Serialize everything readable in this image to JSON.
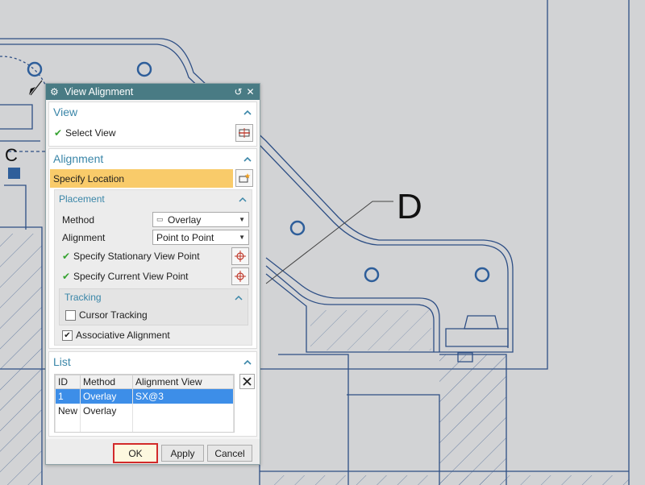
{
  "drawing": {
    "callout_c": "C",
    "callout_d": "D"
  },
  "dialog": {
    "title": "View Alignment",
    "view": {
      "header": "View",
      "select_view_label": "Select View"
    },
    "alignment": {
      "header": "Alignment",
      "specify_location_label": "Specify Location",
      "placement": {
        "header": "Placement",
        "method_label": "Method",
        "method_value": "Overlay",
        "alignment_label": "Alignment",
        "alignment_value": "Point to Point",
        "stationary_point_label": "Specify Stationary View Point",
        "current_point_label": "Specify Current View Point"
      },
      "tracking": {
        "header": "Tracking",
        "cursor_tracking_label": "Cursor Tracking",
        "cursor_tracking_checked": false
      },
      "associative_label": "Associative Alignment",
      "associative_checked": true
    },
    "list": {
      "header": "List",
      "columns": [
        "ID",
        "Method",
        "Alignment View"
      ],
      "rows": [
        {
          "id": "1",
          "method": "Overlay",
          "view": "SX@3",
          "selected": true
        },
        {
          "id": "New",
          "method": "Overlay",
          "view": "",
          "selected": false
        }
      ]
    },
    "buttons": {
      "ok": "OK",
      "apply": "Apply",
      "cancel": "Cancel"
    }
  },
  "colors": {
    "titlebar": "#497b84",
    "header_text": "#3a86a8",
    "highlight_row": "#f9cb6a",
    "selected_row": "#3d8ee8",
    "ok_outline": "#d22a2a"
  }
}
